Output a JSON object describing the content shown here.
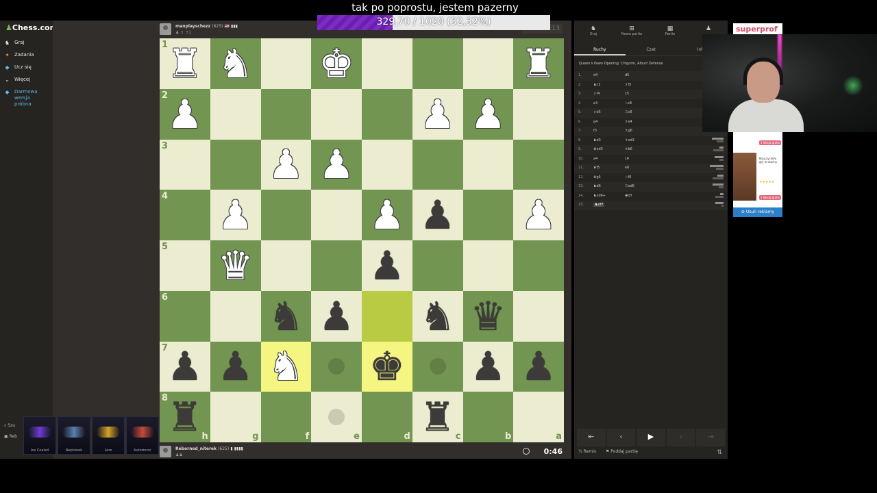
{
  "stream": {
    "title": "tak po poprostu, jestem pazerny",
    "goal_text": "329,70 / 1020 (32,32%)",
    "goal_fraction": 0.3232
  },
  "sidebar": {
    "brand": "Chess.com",
    "items": [
      {
        "label": "Graj",
        "icon": "play-icon"
      },
      {
        "label": "Zadania",
        "icon": "puzzle-icon"
      },
      {
        "label": "Ucz się",
        "icon": "learn-icon"
      },
      {
        "label": "Więcej",
        "icon": "chevron-icon"
      },
      {
        "label": "Darmowa wersja próbna",
        "icon": "diamond-icon"
      }
    ],
    "bottom": [
      "Szu",
      "Reb"
    ]
  },
  "inventory": [
    {
      "name": "Ice Coaled",
      "color": "#6b3dd1"
    },
    {
      "name": "Neptunek",
      "color": "#5a7fa8"
    },
    {
      "name": "Lore",
      "color": "#d9a326"
    },
    {
      "name": "Autotronic",
      "color": "#c84a3a"
    }
  ],
  "top_player": {
    "name": "manplayschezz",
    "rating": "(625)",
    "flag": "🇺🇸 ▮▮▮",
    "captured": "♟ ♗ +1",
    "clock": "2:13"
  },
  "bottom_player": {
    "name": "Reborned_niterek",
    "rating": "(625)",
    "flag": "▮ ▮▮▮▮",
    "captured": "♟♟",
    "clock": "0:46"
  },
  "board": {
    "ranks": [
      "1",
      "2",
      "3",
      "4",
      "5",
      "6",
      "7",
      "8"
    ],
    "files": [
      "h",
      "g",
      "f",
      "e",
      "d",
      "c",
      "b",
      "a"
    ],
    "rows": [
      [
        "wR",
        "wN",
        "",
        "wK",
        "",
        "",
        "",
        "wR"
      ],
      [
        "wP",
        "",
        "",
        "",
        "",
        "wP",
        "wP",
        ""
      ],
      [
        "",
        "",
        "wP",
        "wP",
        "",
        "",
        "",
        ""
      ],
      [
        "",
        "wP",
        "",
        "",
        "wP",
        "bP",
        "",
        "wP"
      ],
      [
        "",
        "wQ",
        "",
        "",
        "bP",
        "",
        "",
        ""
      ],
      [
        "",
        "",
        "bN",
        "bP",
        "",
        "bN",
        "bQ",
        ""
      ],
      [
        "bP",
        "bP",
        "wN",
        "",
        "bK",
        "",
        "bP",
        "bP"
      ],
      [
        "bR",
        "",
        "",
        "",
        "",
        "bR",
        "",
        ""
      ]
    ],
    "highlights": [
      [
        5,
        4
      ],
      [
        6,
        2
      ],
      [
        6,
        4
      ]
    ],
    "hints": [
      [
        6,
        3
      ],
      [
        6,
        5
      ],
      [
        7,
        3
      ]
    ]
  },
  "right_panel": {
    "tabs": [
      {
        "label": "Graj",
        "glyph": "♞"
      },
      {
        "label": "Nowa partia",
        "glyph": "⊞"
      },
      {
        "label": "Partie",
        "glyph": "▦"
      },
      {
        "label": "",
        "glyph": "♟"
      }
    ],
    "subtabs": [
      "Ruchy",
      "Czat",
      "Infor"
    ],
    "opening": "Queen's Pawn Opening: Chigorin, Alburt Defense",
    "moves": [
      {
        "n": "1.",
        "w": "d4",
        "b": "d5",
        "t1": "",
        "t2": ""
      },
      {
        "n": "2.",
        "w": "♞c3",
        "b": "♗f5",
        "t1": "",
        "t2": ""
      },
      {
        "n": "3.",
        "w": "♗f4",
        "b": "c5",
        "t1": "",
        "t2": ""
      },
      {
        "n": "4.",
        "w": "e3",
        "b": "♘c6",
        "t1": "",
        "t2": ""
      },
      {
        "n": "5.",
        "w": "♗b5",
        "b": "♖c8",
        "t1": "",
        "t2": ""
      },
      {
        "n": "6.",
        "w": "g4",
        "b": "♗e4",
        "t1": "",
        "t2": ""
      },
      {
        "n": "7.",
        "w": "f3",
        "b": "♗g6",
        "t1": "",
        "t2": ""
      },
      {
        "n": "8.",
        "w": "♞d3",
        "b": "♗xd3",
        "t1": "",
        "t2": ""
      },
      {
        "n": "9.",
        "w": "♛xd3",
        "b": "♕b6",
        "t1": "",
        "t2": ""
      },
      {
        "n": "10.",
        "w": "a4",
        "b": "c4",
        "t1": "",
        "t2": ""
      },
      {
        "n": "11.",
        "w": "♛f5",
        "b": "e6",
        "t1": "",
        "t2": ""
      },
      {
        "n": "12.",
        "w": "♛g5",
        "b": "♘f6",
        "t1": "",
        "t2": ""
      },
      {
        "n": "13.",
        "w": "♞d6",
        "b": "♖xd6",
        "t1": "",
        "t2": ""
      },
      {
        "n": "14.",
        "w": "♞xd6+",
        "b": "♚d7",
        "t1": "",
        "t2": ""
      },
      {
        "n": "15.",
        "w": "♞xf7",
        "b": "",
        "t1": "",
        "t2": ""
      }
    ],
    "controls": [
      "⇤",
      "‹",
      "▶",
      "›",
      "⇥"
    ],
    "actions": [
      "½ Remis",
      "⚑ Poddaj partię"
    ],
    "flip": "⇅"
  },
  "ad": {
    "top_word": "superprof",
    "btn1": "1 lekcja gratis",
    "text": "Nauczyciel/a gry w szachy",
    "stars": "★★★★★",
    "btn2": "1 lekcja gratis",
    "remove": "⊘ Usuń reklamy"
  }
}
